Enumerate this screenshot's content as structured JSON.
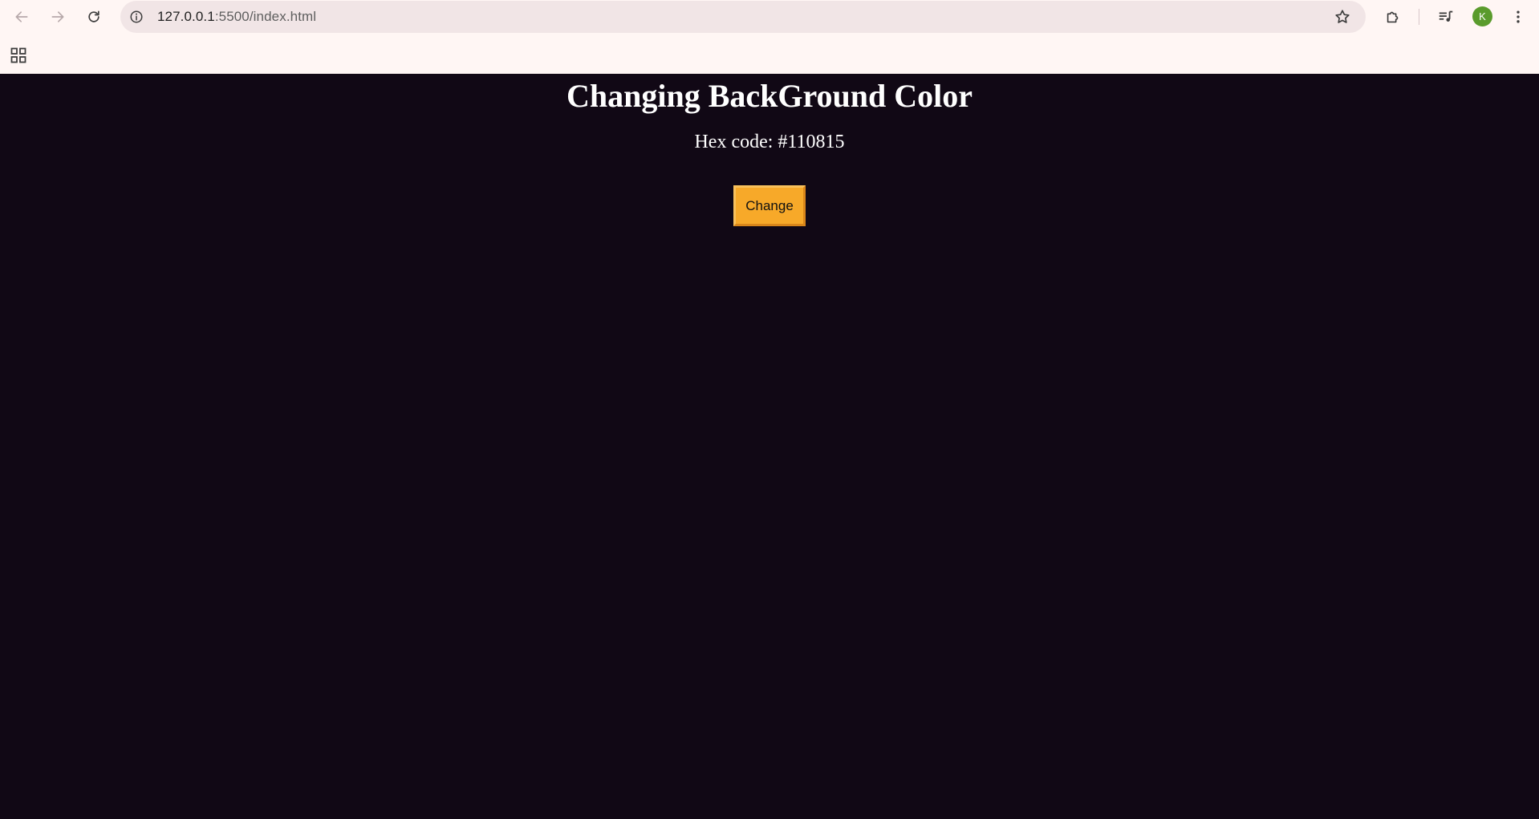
{
  "browser": {
    "url_host": "127.0.0.1",
    "url_path": ":5500/index.html",
    "profile_initial": "K",
    "icons": {
      "back": "arrow-left-icon",
      "forward": "arrow-right-icon",
      "reload": "reload-icon",
      "site_info": "info-icon",
      "bookmark": "star-icon",
      "extensions": "puzzle-icon",
      "media": "media-queue-icon",
      "menu": "kebab-menu-icon",
      "apps": "apps-grid-icon"
    }
  },
  "page": {
    "title": "Changing BackGround Color",
    "hex_label": "Hex code: #110815",
    "button_label": "Change",
    "background_color": "#110815"
  },
  "colors": {
    "button": "#f7a929",
    "text": "#ffffff",
    "chrome": "#fff6f4",
    "avatar": "#5a9b2c"
  }
}
